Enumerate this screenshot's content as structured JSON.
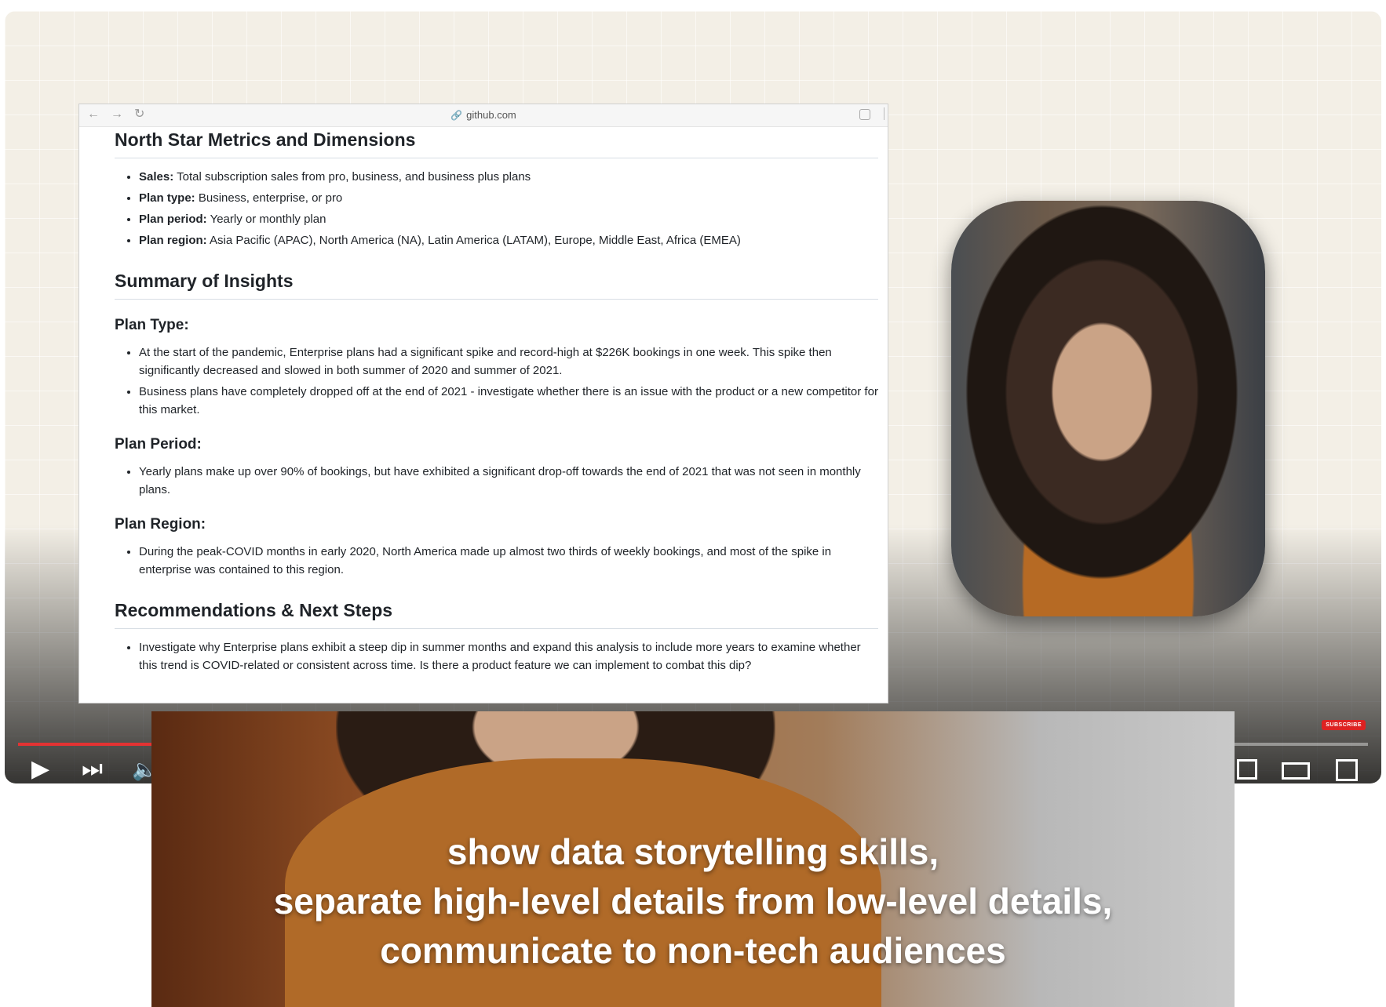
{
  "browser": {
    "url": "github.com"
  },
  "doc": {
    "metrics": {
      "heading": "North Star Metrics and Dimensions",
      "items": [
        {
          "label": "Sales:",
          "text": " Total subscription sales from pro, business, and business plus plans"
        },
        {
          "label": "Plan type:",
          "text": " Business, enterprise, or pro"
        },
        {
          "label": "Plan period:",
          "text": " Yearly or monthly plan"
        },
        {
          "label": "Plan region:",
          "text": " Asia Pacific (APAC), North America (NA), Latin America (LATAM), Europe, Middle East, Africa (EMEA)"
        }
      ]
    },
    "insights": {
      "heading": "Summary of Insights",
      "plan_type": {
        "heading": "Plan Type:",
        "items": [
          "At the start of the pandemic, Enterprise plans had a significant spike and record-high at $226K bookings in one week. This spike then significantly decreased and slowed in both summer of 2020 and summer of 2021.",
          "Business plans have completely dropped off at the end of 2021 - investigate whether there is an issue with the product or a new competitor for this market."
        ]
      },
      "plan_period": {
        "heading": "Plan Period:",
        "items": [
          "Yearly plans make up over 90% of bookings, but have exhibited a significant drop-off towards the end of 2021 that was not seen in monthly plans."
        ]
      },
      "plan_region": {
        "heading": "Plan Region:",
        "items": [
          "During the peak-COVID months in early 2020, North America made up almost two thirds of weekly bookings, and most of the spike in enterprise was contained to this region."
        ]
      }
    },
    "recommendations": {
      "heading": "Recommendations & Next Steps",
      "items": [
        "Investigate why Enterprise plans exhibit a steep dip in summer months and expand this analysis to include more years to examine whether this trend is COVID-related or consistent across time. Is there a product feature we can implement to combat this dip?"
      ]
    }
  },
  "player": {
    "progress_fraction": 0.1,
    "subscribe_label": "SUBSCRIBE",
    "accent_color": "#e33333"
  },
  "caption": {
    "lines": [
      "show data storytelling skills,",
      "separate high-level details from low-level details,",
      "communicate to non-tech audiences"
    ]
  }
}
